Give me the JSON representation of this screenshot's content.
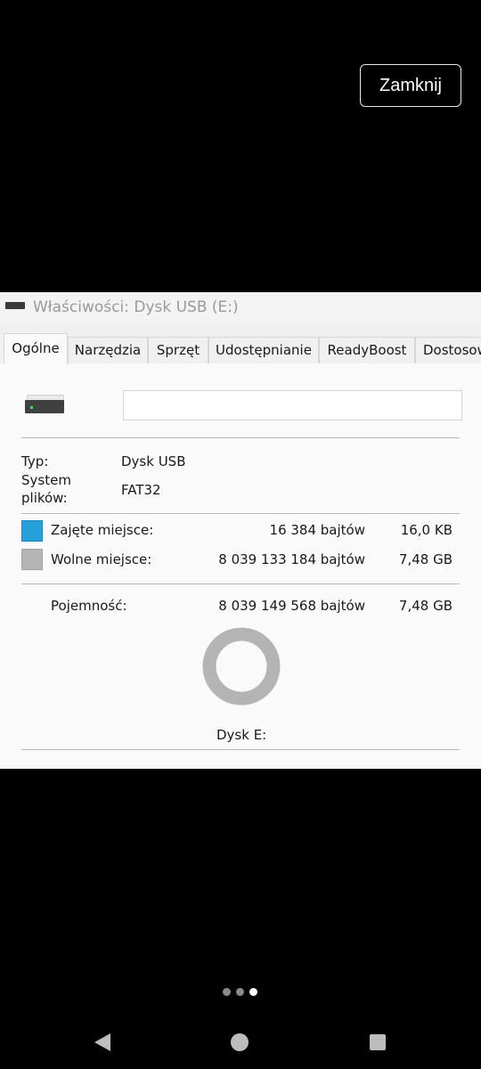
{
  "overlay": {
    "close_label": "Zamknij"
  },
  "window": {
    "title": "Właściwości: Dysk USB (E:)",
    "tabs": [
      "Ogólne",
      "Narzędzia",
      "Sprzęt",
      "Udostępnianie",
      "ReadyBoost",
      "Dostosow"
    ],
    "active_tab": "Ogólne"
  },
  "general": {
    "name_value": "",
    "type_label": "Typ:",
    "type_value": "Dysk USB",
    "fs_label_line1": "System",
    "fs_label_line2": "plików:",
    "fs_value": "FAT32",
    "used_label": "Zajęte miejsce:",
    "used_bytes": "16 384 bajtów",
    "used_size": "16,0 KB",
    "free_label": "Wolne miejsce:",
    "free_bytes": "8 039 133 184 bajtów",
    "free_size": "7,48 GB",
    "capacity_label": "Pojemność:",
    "capacity_bytes": "8 039 149 568 bajtów",
    "capacity_size": "7,48 GB",
    "disk_label": "Dysk E:",
    "used_fraction": 2e-06,
    "colors": {
      "used": "#26a0da",
      "free": "#b4b4b4"
    }
  },
  "pager": {
    "count": 3,
    "active_index": 2
  },
  "navbar": {
    "icons": [
      "back-icon",
      "home-icon",
      "recents-icon"
    ]
  }
}
